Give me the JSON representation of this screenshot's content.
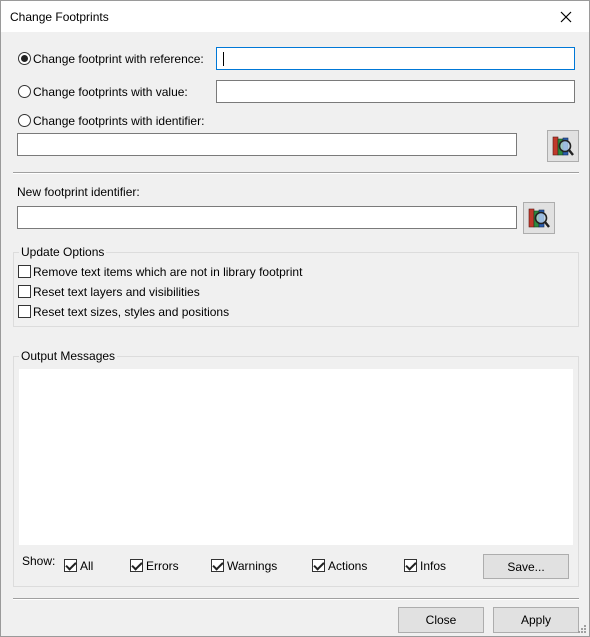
{
  "window": {
    "title": "Change Footprints"
  },
  "options": {
    "by_reference": {
      "label": "Change footprint with reference:",
      "value": "",
      "selected": true
    },
    "by_value": {
      "label": "Change footprints with value:",
      "value": "",
      "selected": false
    },
    "by_identifier": {
      "label": "Change footprints with identifier:",
      "value": "",
      "selected": false
    }
  },
  "new_footprint": {
    "label": "New footprint identifier:",
    "value": ""
  },
  "update_options": {
    "title": "Update Options",
    "items": [
      {
        "label": "Remove text items which are not in library footprint",
        "checked": false
      },
      {
        "label": "Reset text layers and visibilities",
        "checked": false
      },
      {
        "label": "Reset text sizes, styles and positions",
        "checked": false
      }
    ]
  },
  "output": {
    "title": "Output Messages",
    "show_label": "Show:",
    "filters": [
      {
        "label": "All",
        "checked": true
      },
      {
        "label": "Errors",
        "checked": true
      },
      {
        "label": "Warnings",
        "checked": true
      },
      {
        "label": "Actions",
        "checked": true
      },
      {
        "label": "Infos",
        "checked": true
      }
    ],
    "save_label": "Save..."
  },
  "buttons": {
    "close_label": "Close",
    "apply_label": "Apply"
  },
  "icons": {
    "close": "close-icon",
    "browse": "library-browser-icon",
    "resize": "resize-grip-icon"
  },
  "colors": {
    "focus_border": "#0078d7",
    "button_bg": "#e1e1e1"
  }
}
